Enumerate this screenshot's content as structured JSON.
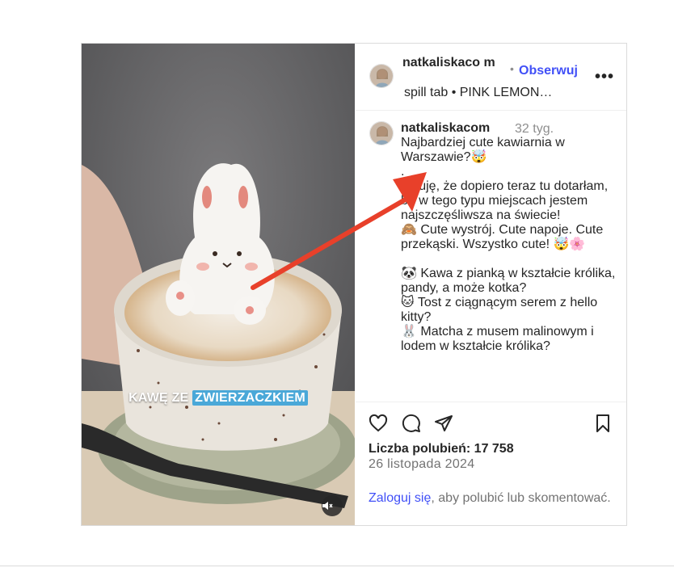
{
  "post": {
    "username": "natkaliskacom",
    "header_username": "natkaliskaco m",
    "follow_label": "Obserwuj",
    "audio_line": "spill tab • PINK LEMON…",
    "video_overlay": {
      "word1": "KAWĘ ZE ",
      "word2": "ZWIERZACZKIEM"
    },
    "more_icon": "more-horizontal-icon",
    "mute_icon": "speaker-muted-icon"
  },
  "caption": {
    "time": "32 tyg.",
    "text": "Najbardziej cute kawiarnia w Warszawie?🤯\n.\nŻałuję, że dopiero teraz tu dotarłam, bo w tego typu miejscach jestem najszczęśliwsza na świecie!\n🙈 Cute wystrój. Cute napoje. Cute przekąski. Wszystko cute! 🤯🌸\n\n🐼 Kawa z pianką w kształcie królika, pandy, a może kotka?\n🐱 Tost z ciągnącym serem z hello kitty?\n🐰 Matcha z musem malinowym i lodem w kształcie królika?"
  },
  "actions": {
    "icons": [
      "heart-icon",
      "comment-icon",
      "share-icon",
      "bookmark-icon"
    ],
    "likes_label": "Liczba polubień: 17 758",
    "date": "26 listopada 2024",
    "login_link": "Zaloguj się",
    "login_rest": ", aby polubić lub skomentować."
  },
  "colors": {
    "link": "#4150f7",
    "annotation_arrow": "#e8402a",
    "highlight": "#4aa8d8"
  }
}
